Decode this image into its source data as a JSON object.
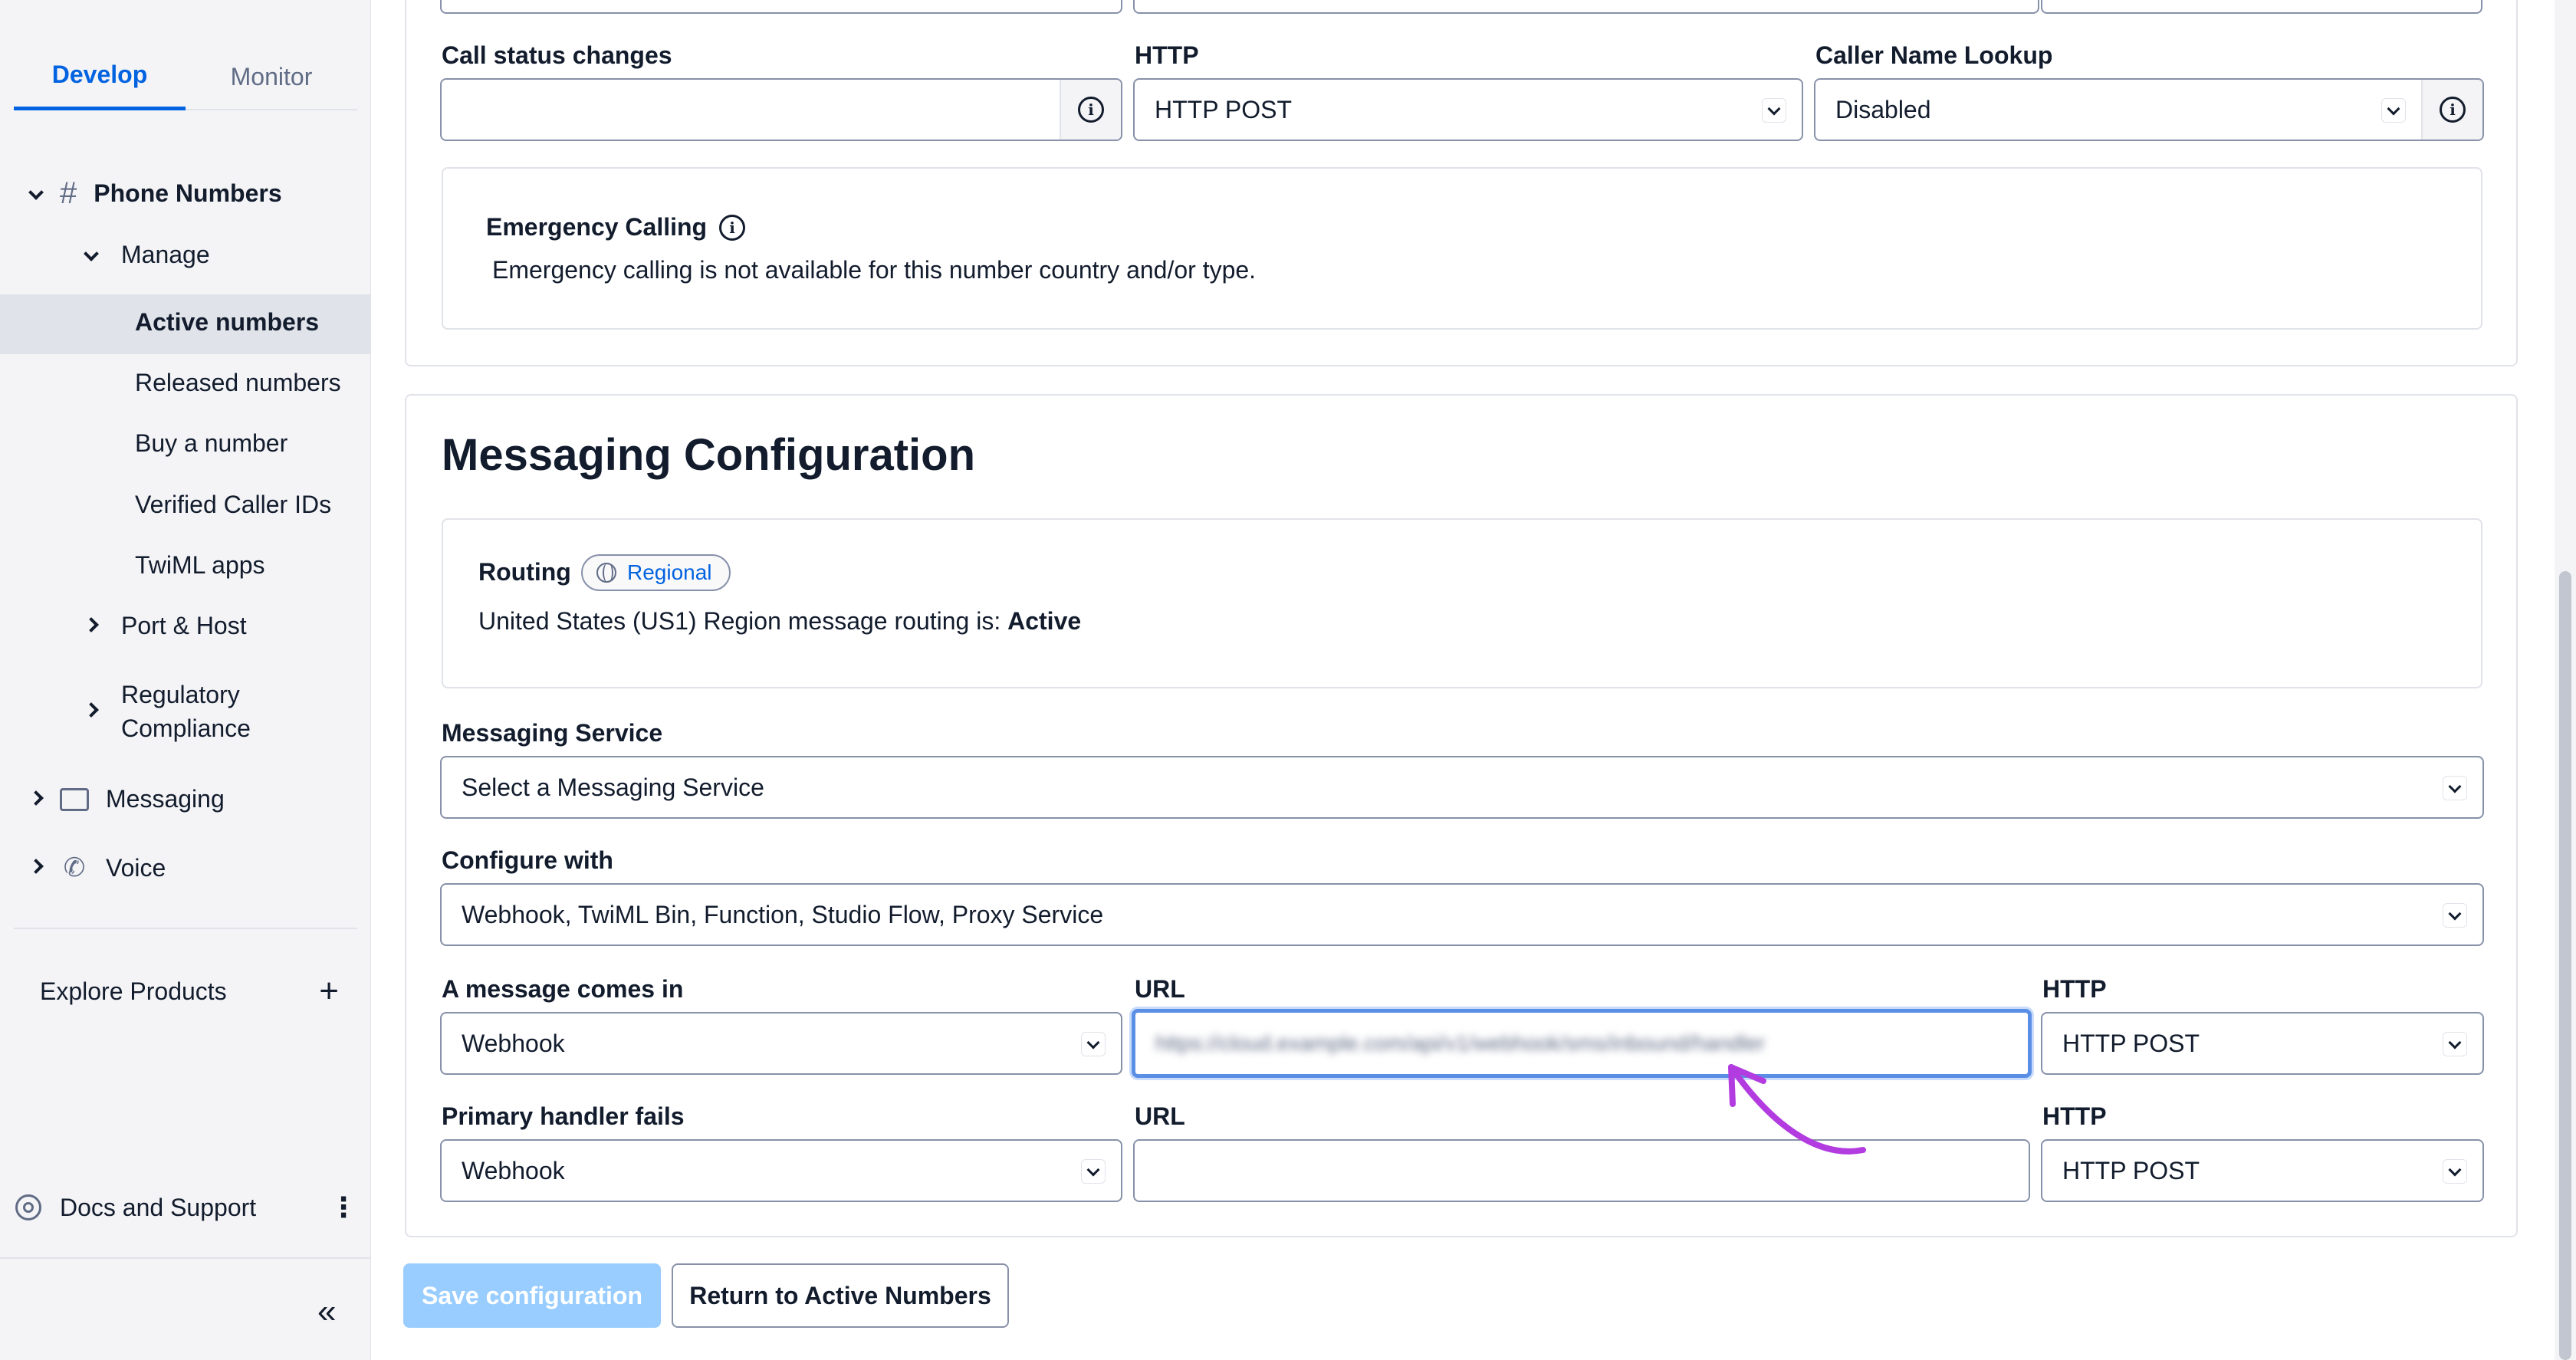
{
  "sidebar": {
    "tabs": [
      "Develop",
      "Monitor"
    ],
    "section": "Phone Numbers",
    "manage": "Manage",
    "items": [
      "Active numbers",
      "Released numbers",
      "Buy a number",
      "Verified Caller IDs",
      "TwiML apps"
    ],
    "port_host": "Port & Host",
    "regulatory_1": "Regulatory",
    "regulatory_2": "Compliance",
    "messaging": "Messaging",
    "voice": "Voice",
    "explore": "Explore Products",
    "docs": "Docs and Support"
  },
  "voice_config": {
    "call_status_label": "Call status changes",
    "call_status_value": "",
    "http_label": "HTTP",
    "http_value": "HTTP POST",
    "caller_name_label": "Caller Name Lookup",
    "caller_name_value": "Disabled",
    "emergency_title": "Emergency Calling",
    "emergency_text": "Emergency calling is not available for this number country and/or type."
  },
  "messaging": {
    "title": "Messaging Configuration",
    "routing_label": "Routing",
    "routing_badge": "Regional",
    "routing_text": "United States (US1) Region message routing is: ",
    "routing_status": "Active",
    "service_label": "Messaging Service",
    "service_value": "Select a Messaging Service",
    "configure_label": "Configure with",
    "configure_value": "Webhook, TwiML Bin, Function, Studio Flow, Proxy Service",
    "incoming_label": "A message comes in",
    "incoming_value": "Webhook",
    "url_label": "URL",
    "url_value": "https://cloud.example.com/api/v1/webhook/sms/inbound/handler",
    "http_label": "HTTP",
    "http_value": "HTTP POST",
    "fail_label": "Primary handler fails",
    "fail_value": "Webhook",
    "fail_url_label": "URL",
    "fail_url_value": "",
    "fail_http_label": "HTTP",
    "fail_http_value": "HTTP POST"
  },
  "actions": {
    "save": "Save configuration",
    "return": "Return to Active Numbers"
  },
  "colors": {
    "accent": "#0263e0",
    "annotation": "#b23ce0",
    "disabled_primary": "#99cdff"
  }
}
